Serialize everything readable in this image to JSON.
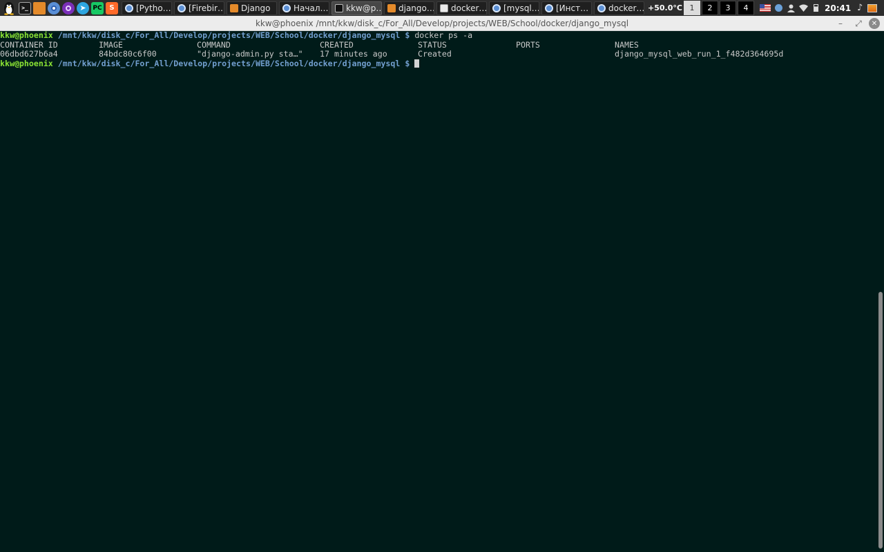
{
  "panel": {
    "launchers": [
      {
        "name": "start-menu",
        "icon": "linux-penguin-icon",
        "glyph": "🐧"
      },
      {
        "name": "terminal",
        "icon": "terminal-icon",
        "glyph": ">_"
      },
      {
        "name": "file-manager",
        "icon": "folder-icon",
        "glyph": ""
      },
      {
        "name": "chromium",
        "icon": "chromium-icon",
        "glyph": ""
      },
      {
        "name": "tor-browser",
        "icon": "tor-icon",
        "glyph": ""
      },
      {
        "name": "telegram",
        "icon": "telegram-icon",
        "glyph": "➤"
      },
      {
        "name": "pycharm",
        "icon": "pycharm-icon",
        "glyph": "PC"
      },
      {
        "name": "sublime",
        "icon": "sublime-icon",
        "glyph": "S"
      }
    ],
    "tasks": [
      {
        "label": "[Pytho…",
        "icon": "browser",
        "active": false,
        "width": 73
      },
      {
        "label": "[Firebir…",
        "icon": "browser",
        "active": false,
        "width": 73
      },
      {
        "label": "Django",
        "icon": "folder",
        "active": false,
        "width": 73
      },
      {
        "label": "Начал…",
        "icon": "browser",
        "active": false,
        "width": 73
      },
      {
        "label": "kkw@p…",
        "icon": "term",
        "active": true,
        "width": 73
      },
      {
        "label": "django…",
        "icon": "folder",
        "active": false,
        "width": 73
      },
      {
        "label": "docker…",
        "icon": "doc",
        "active": false,
        "width": 73
      },
      {
        "label": "[mysql…",
        "icon": "browser",
        "active": false,
        "width": 73
      },
      {
        "label": "[Инст…",
        "icon": "browser",
        "active": false,
        "width": 73
      },
      {
        "label": "docker…",
        "icon": "browser",
        "active": false,
        "width": 73
      }
    ],
    "temperature": "+50.0°C",
    "workspaces": [
      "1",
      "2",
      "3",
      "4"
    ],
    "active_workspace": "1",
    "clock": "20:41"
  },
  "window": {
    "title": "kkw@phoenix /mnt/kkw/disk_c/For_All/Develop/projects/WEB/School/docker/django_mysql",
    "buttons": {
      "minimize": "–",
      "maximize": "⤢",
      "close": "✕"
    }
  },
  "terminal": {
    "prompt_user": "kkw@phoenix",
    "prompt_path": "/mnt/kkw/disk_c/For_All/Develop/projects/WEB/School/docker/django_mysql",
    "prompt_symbol": "$",
    "command": "docker ps -a",
    "table": {
      "headers": [
        "CONTAINER ID",
        "IMAGE",
        "COMMAND",
        "CREATED",
        "STATUS",
        "PORTS",
        "NAMES"
      ],
      "rows": [
        [
          "06dbd627b6a4",
          "84bdc80c6f00",
          "\"django-admin.py sta…\"",
          "17 minutes ago",
          "Created",
          "",
          "django_mysql_web_run_1_f482d364695d"
        ]
      ]
    }
  },
  "colors": {
    "terminal_bg": "#001b19",
    "prompt_user": "#8ae234",
    "prompt_path": "#729fcf",
    "text": "#c8c8c8"
  }
}
